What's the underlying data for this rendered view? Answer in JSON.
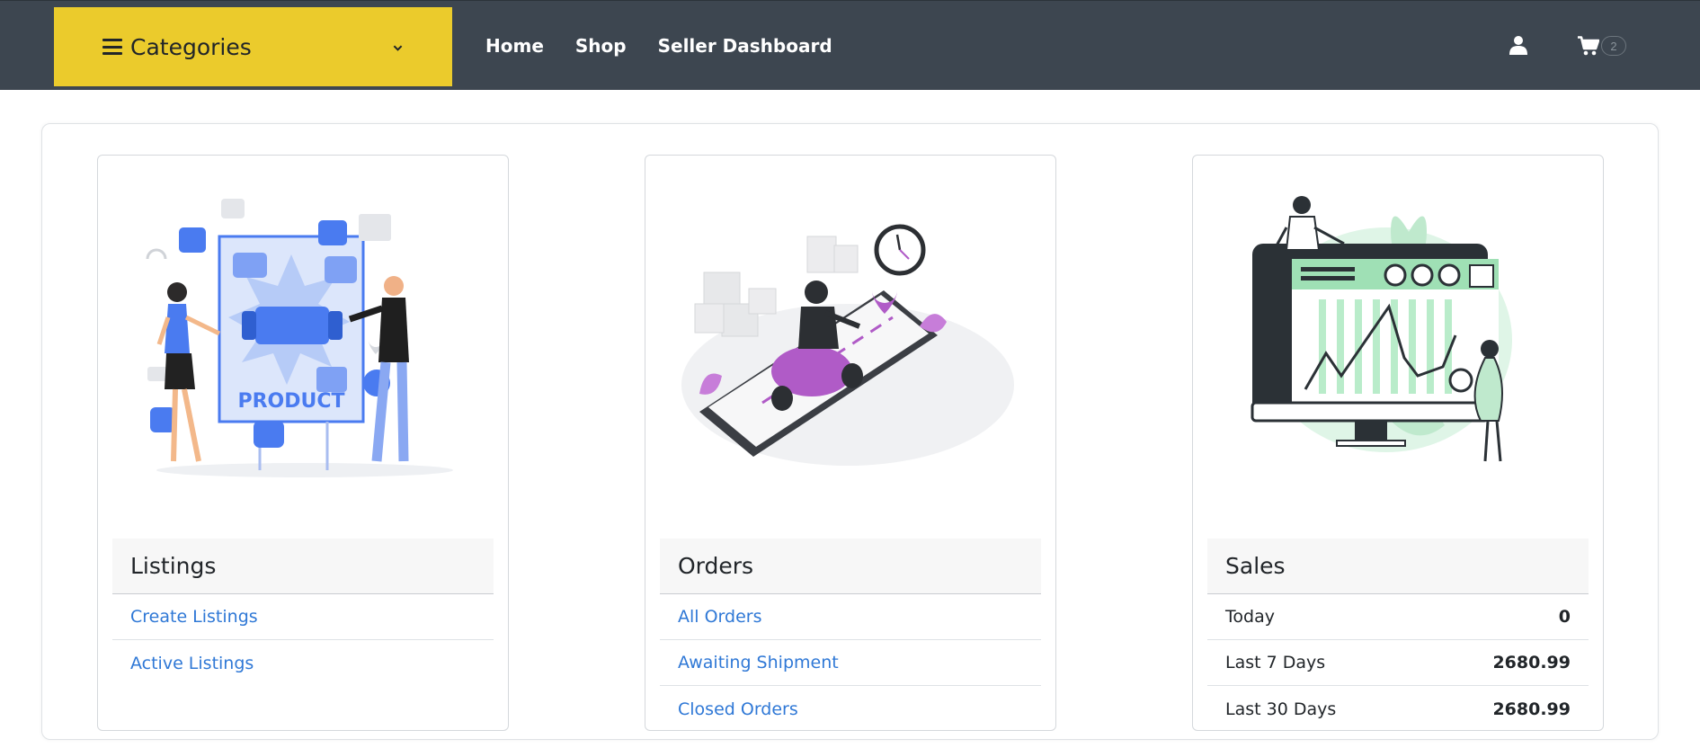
{
  "nav": {
    "categories_label": "Categories",
    "links": [
      "Home",
      "Shop",
      "Seller Dashboard"
    ],
    "cart_count": "2"
  },
  "listings": {
    "title": "Listings",
    "illustration_text": "PRODUCT",
    "links": [
      "Create Listings",
      "Active Listings"
    ]
  },
  "orders": {
    "title": "Orders",
    "links": [
      "All Orders",
      "Awaiting Shipment",
      "Closed Orders"
    ]
  },
  "sales": {
    "title": "Sales",
    "rows": [
      {
        "label": "Today",
        "value": "0"
      },
      {
        "label": "Last 7 Days",
        "value": "2680.99"
      },
      {
        "label": "Last 30 Days",
        "value": "2680.99"
      }
    ]
  },
  "colors": {
    "navbar": "#3d4650",
    "categories_bg": "#ebcb2c",
    "link": "#2f78d6",
    "illustration_blue": "#4a7bf0",
    "illustration_purple": "#b05bc7",
    "illustration_green": "#a8e6bf"
  }
}
